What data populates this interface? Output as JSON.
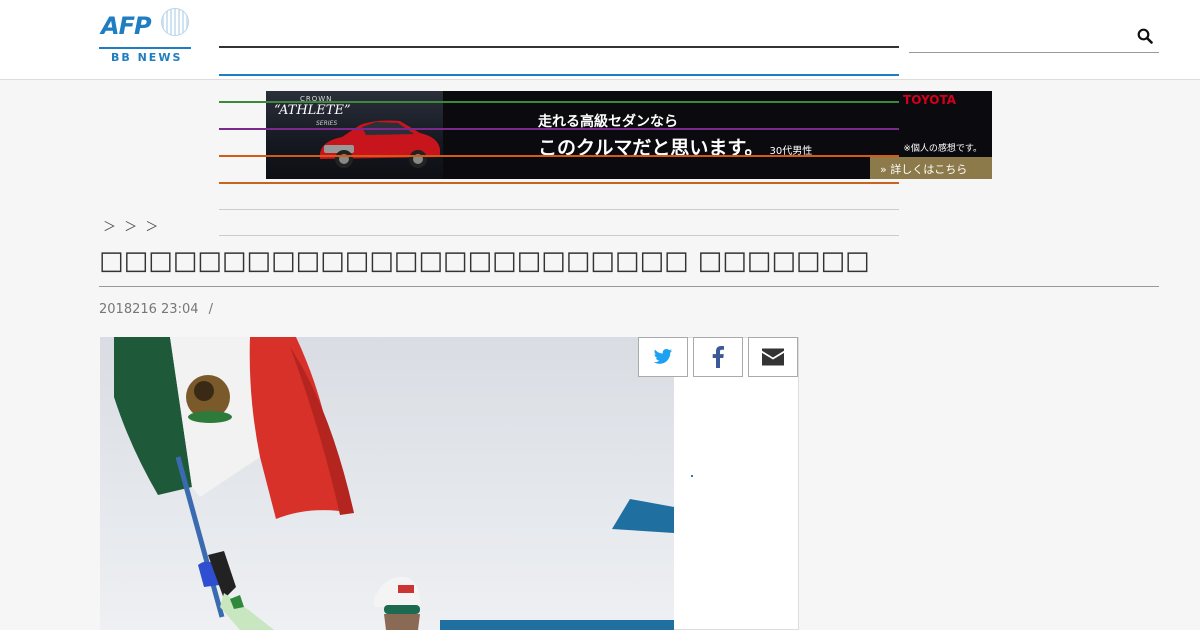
{
  "header": {
    "logo_text": "AFP",
    "logo_sub": "BB NEWS",
    "nav_colors": [
      "#333333",
      "#1f7ec2",
      "#3a8a3a",
      "#7a2a8a",
      "#d45a1a",
      "#c8641e",
      "#cccccc",
      "#cccccc"
    ],
    "search_icon": "search-icon"
  },
  "ad": {
    "brand_small": "CROWN",
    "brand": "“ATHLETE”",
    "series": "SERIES",
    "toyota": "TOYOTA",
    "line1": "走れる高級セダンなら",
    "line2": "このクルマだと思います。",
    "line2_note": "30代男性",
    "note": "※個人の感想です。",
    "cta": "詳しくはこちら"
  },
  "breadcrumb": "＞ ＞ ＞",
  "article": {
    "title": "□□□□□□□□□□□□□□□□□□□□□□□□ □□□□□□□",
    "date": "2018216 23:04",
    "separator": "/"
  },
  "share": {
    "twitter_icon": "twitter-icon",
    "facebook_icon": "facebook-icon",
    "email_icon": "email-icon",
    "colors": {
      "twitter": "#1da1f2",
      "facebook": "#3b5998",
      "email": "#333333"
    }
  }
}
